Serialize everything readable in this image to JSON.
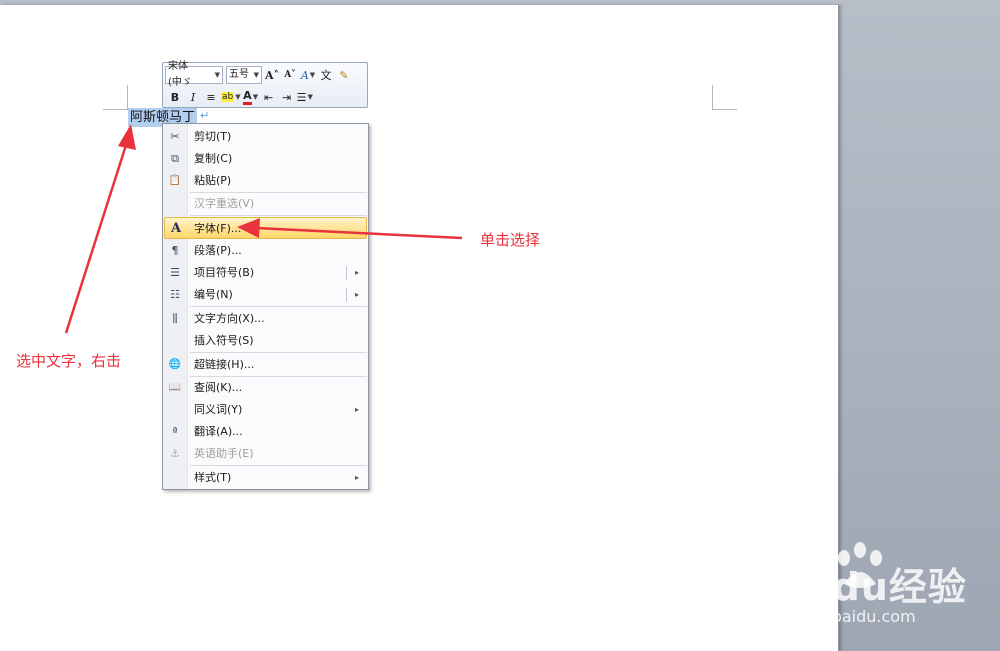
{
  "document": {
    "selected_text": "阿斯顿马丁",
    "paragraph_mark": "↵"
  },
  "mini_toolbar": {
    "font_name": "宋体 (中ゞ",
    "font_size": "五号",
    "row1_buttons": [
      {
        "name": "grow-font-icon",
        "glyph": "A˄"
      },
      {
        "name": "shrink-font-icon",
        "glyph": "A˅"
      },
      {
        "name": "styles-icon",
        "glyph": "A"
      },
      {
        "name": "phonetic-guide-icon",
        "glyph": "文"
      },
      {
        "name": "format-painter-icon",
        "glyph": "✎"
      }
    ],
    "row2_buttons": [
      {
        "name": "bold-icon",
        "glyph": "B"
      },
      {
        "name": "italic-icon",
        "glyph": "I"
      },
      {
        "name": "center-align-icon",
        "glyph": "≡"
      },
      {
        "name": "highlight-color-icon",
        "glyph": "ab"
      },
      {
        "name": "font-color-icon",
        "glyph": "A"
      },
      {
        "name": "decrease-indent-icon",
        "glyph": "⇤"
      },
      {
        "name": "increase-indent-icon",
        "glyph": "⇥"
      },
      {
        "name": "bullets-icon",
        "glyph": "☰"
      }
    ]
  },
  "context_menu": {
    "items": [
      {
        "label": "剪切(T)",
        "icon": "✂",
        "icon_name": "scissors-icon"
      },
      {
        "label": "复制(C)",
        "icon": "⧉",
        "icon_name": "copy-icon"
      },
      {
        "label": "粘贴(P)",
        "icon": "📋",
        "icon_name": "clipboard-icon"
      },
      {
        "label": "汉字重选(V)",
        "icon": "",
        "icon_name": "none",
        "disabled": true
      },
      {
        "label": "字体(F)...",
        "icon": "A",
        "icon_name": "font-icon",
        "highlight": true
      },
      {
        "label": "段落(P)...",
        "icon": "¶",
        "icon_name": "paragraph-icon"
      },
      {
        "label": "项目符号(B)",
        "icon": "☰",
        "icon_name": "bullets-icon",
        "submenu": true
      },
      {
        "label": "编号(N)",
        "icon": "☷",
        "icon_name": "numbering-icon",
        "submenu": true
      },
      {
        "label": "文字方向(X)...",
        "icon": "⫼",
        "icon_name": "text-direction-icon"
      },
      {
        "label": "插入符号(S)",
        "icon": "",
        "icon_name": "none"
      },
      {
        "label": "超链接(H)...",
        "icon": "🌐",
        "icon_name": "hyperlink-icon"
      },
      {
        "label": "查阅(K)...",
        "icon": "📖",
        "icon_name": "research-icon"
      },
      {
        "label": "同义词(Y)",
        "icon": "",
        "icon_name": "none",
        "submenu": true
      },
      {
        "label": "翻译(A)...",
        "icon": "ª",
        "icon_name": "translate-icon"
      },
      {
        "label": "英语助手(E)",
        "icon": "⚓",
        "icon_name": "english-assistant-icon",
        "disabled": true
      },
      {
        "label": "样式(T)",
        "icon": "",
        "icon_name": "none",
        "submenu": true
      }
    ],
    "submenu_glyph": "▸"
  },
  "annotations": {
    "left": "选中文字，右击",
    "right": "单击选择",
    "color": "#e8323c"
  },
  "watermark": {
    "brand": "Baidu经验",
    "url": "jingyan.baidu.com"
  }
}
